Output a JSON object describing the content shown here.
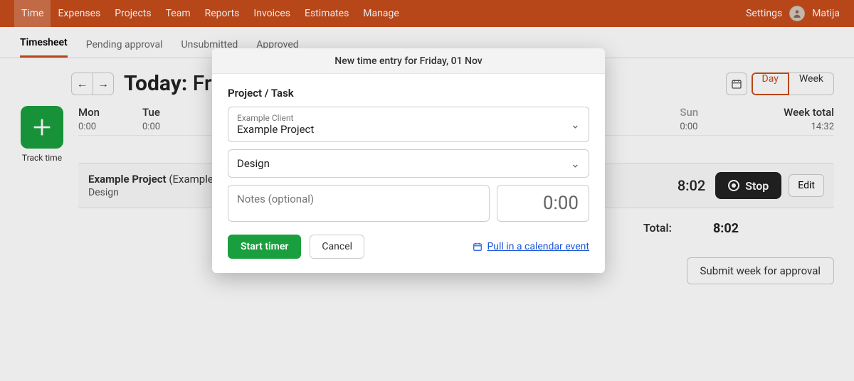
{
  "nav": {
    "items": [
      "Time",
      "Expenses",
      "Projects",
      "Team",
      "Reports",
      "Invoices",
      "Estimates",
      "Manage"
    ],
    "active_index": 0,
    "settings": "Settings",
    "user": "Matija"
  },
  "subnav": {
    "tabs": [
      "Timesheet",
      "Pending approval",
      "Unsubmitted",
      "Approved"
    ],
    "active_index": 0
  },
  "header": {
    "today_label": "Today:",
    "date_fragment": "Fri",
    "view_day": "Day",
    "view_week": "Week",
    "active_view": "Day"
  },
  "track": {
    "label": "Track time"
  },
  "days": [
    {
      "name": "Mon",
      "value": "0:00",
      "dim": false
    },
    {
      "name": "Tue",
      "value": "0:00",
      "dim": false
    },
    {
      "name": "Sun",
      "value": "0:00",
      "dim": true
    }
  ],
  "week_total": {
    "label": "Week total",
    "value": "14:32"
  },
  "entry": {
    "project": "Example Project",
    "client_fragment": "(Example C",
    "task": "Design",
    "time": "8:02",
    "stop": "Stop",
    "edit": "Edit"
  },
  "totals": {
    "label": "Total:",
    "value": "8:02"
  },
  "submit": {
    "label": "Submit week for approval"
  },
  "modal": {
    "title": "New time entry for Friday, 01 Nov",
    "section_label": "Project / Task",
    "client": "Example Client",
    "project": "Example Project",
    "task": "Design",
    "notes_placeholder": "Notes (optional)",
    "time_value": "0:00",
    "start": "Start timer",
    "cancel": "Cancel",
    "pull_calendar": "Pull in a calendar event"
  }
}
